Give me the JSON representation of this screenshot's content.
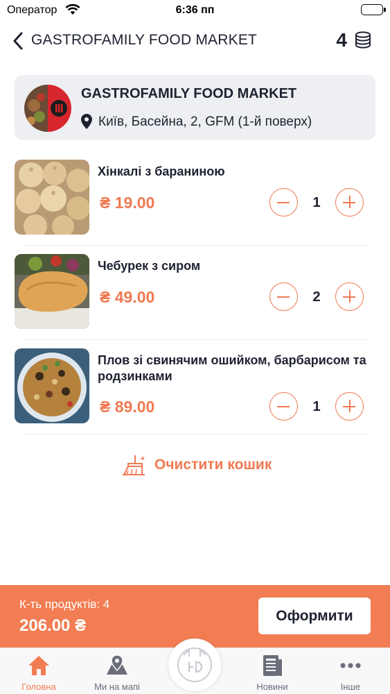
{
  "status_bar": {
    "carrier": "Оператор",
    "time": "6:36 пп"
  },
  "header": {
    "title": "GASTROFAMILY FOOD MARKET",
    "coins": "4"
  },
  "store": {
    "name": "GASTROFAMILY FOOD MARKET",
    "address": "Київ, Басейна, 2, GFM (1-й поверх)"
  },
  "cart": {
    "items": [
      {
        "name": "Хінкалі з бараниною",
        "price": "₴ 19.00",
        "quantity": "1"
      },
      {
        "name": "Чебурек з сиром",
        "price": "₴ 49.00",
        "quantity": "2"
      },
      {
        "name": "Плов зі свинячим ошийком, барбарисом та родзинками",
        "price": "₴ 89.00",
        "quantity": "1"
      }
    ],
    "clear_label": "Очистити кошик"
  },
  "checkout": {
    "count_label": "К-ть продуктів: 4",
    "total": "206.00 ₴",
    "button_label": "Оформити"
  },
  "tabs": [
    {
      "label": "Головна",
      "icon": "home-icon",
      "active": true
    },
    {
      "label": "Ми на мапі",
      "icon": "map-icon",
      "active": false
    },
    {
      "label": "Новини",
      "icon": "news-icon",
      "active": false
    },
    {
      "label": "Інше",
      "icon": "more-icon",
      "active": false
    }
  ],
  "colors": {
    "accent": "#f37d53",
    "price": "#ef7a52",
    "text": "#1e2230",
    "card": "#eeeff2"
  }
}
